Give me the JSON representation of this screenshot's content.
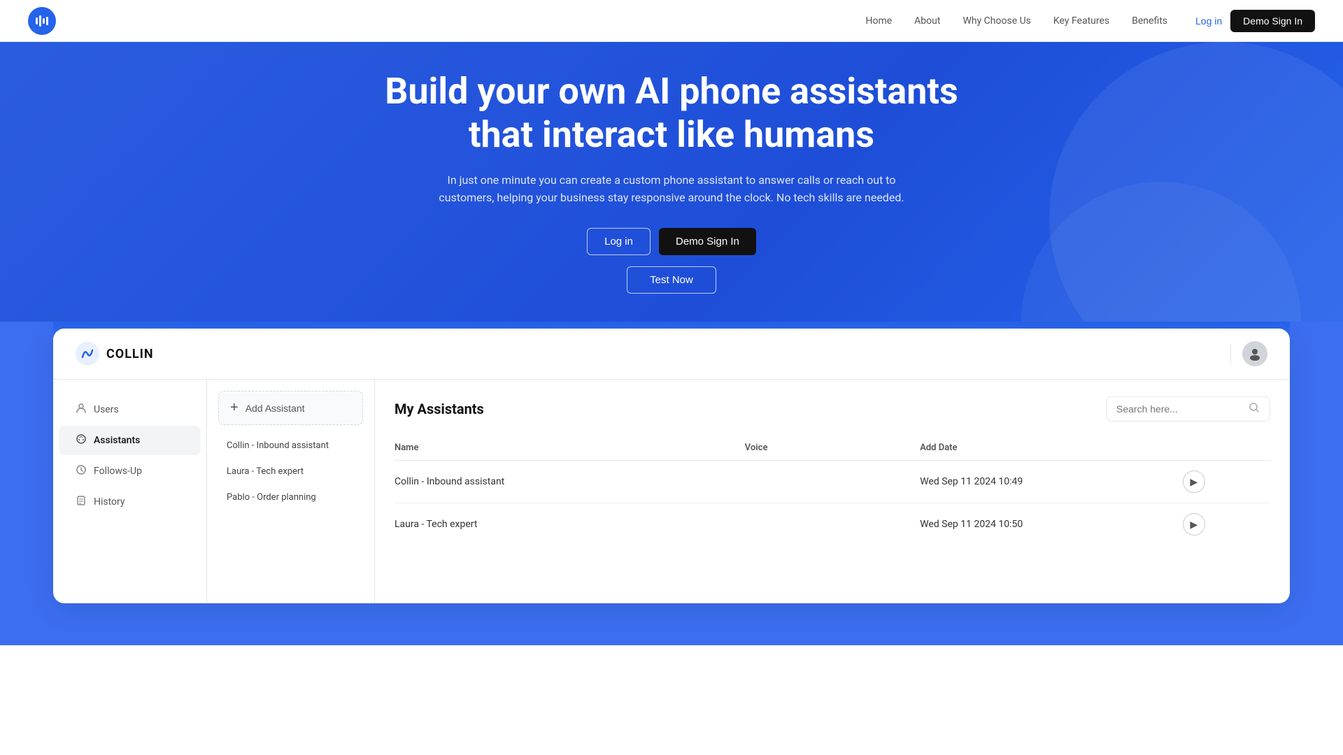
{
  "navbar": {
    "logo_icon": "▐",
    "links": [
      "Home",
      "About",
      "Why Choose Us",
      "Key Features",
      "Benefits"
    ],
    "login_label": "Log in",
    "demo_signin_label": "Demo Sign In"
  },
  "hero": {
    "headline": "Build your own AI phone assistants that interact like humans",
    "subtext": "In just one minute you can create a custom phone assistant to answer calls or reach out to customers, helping your business stay responsive around the clock. No tech skills are needed.",
    "login_label": "Log in",
    "demo_label": "Demo Sign In",
    "test_label": "Test Now"
  },
  "app": {
    "logo_text": "COLLIN",
    "sidebar": {
      "items": [
        {
          "label": "Users",
          "icon": "👤"
        },
        {
          "label": "Assistants",
          "icon": "🎧"
        },
        {
          "label": "Follows-Up",
          "icon": "🔄"
        },
        {
          "label": "History",
          "icon": "📋"
        }
      ]
    },
    "middle": {
      "add_button_label": "Add Assistant",
      "assistants": [
        {
          "label": "Collin - Inbound assistant"
        },
        {
          "label": "Laura - Tech expert"
        },
        {
          "label": "Pablo - Order planning"
        }
      ]
    },
    "main": {
      "title": "My Assistants",
      "search_placeholder": "Search here...",
      "table": {
        "columns": [
          "Name",
          "Voice",
          "Add Date"
        ],
        "rows": [
          {
            "name": "Collin - Inbound assistant",
            "voice": "",
            "date": "Wed Sep 11 2024  10:49"
          },
          {
            "name": "Laura - Tech expert",
            "voice": "",
            "date": "Wed Sep 11 2024  10:50"
          }
        ]
      }
    }
  }
}
